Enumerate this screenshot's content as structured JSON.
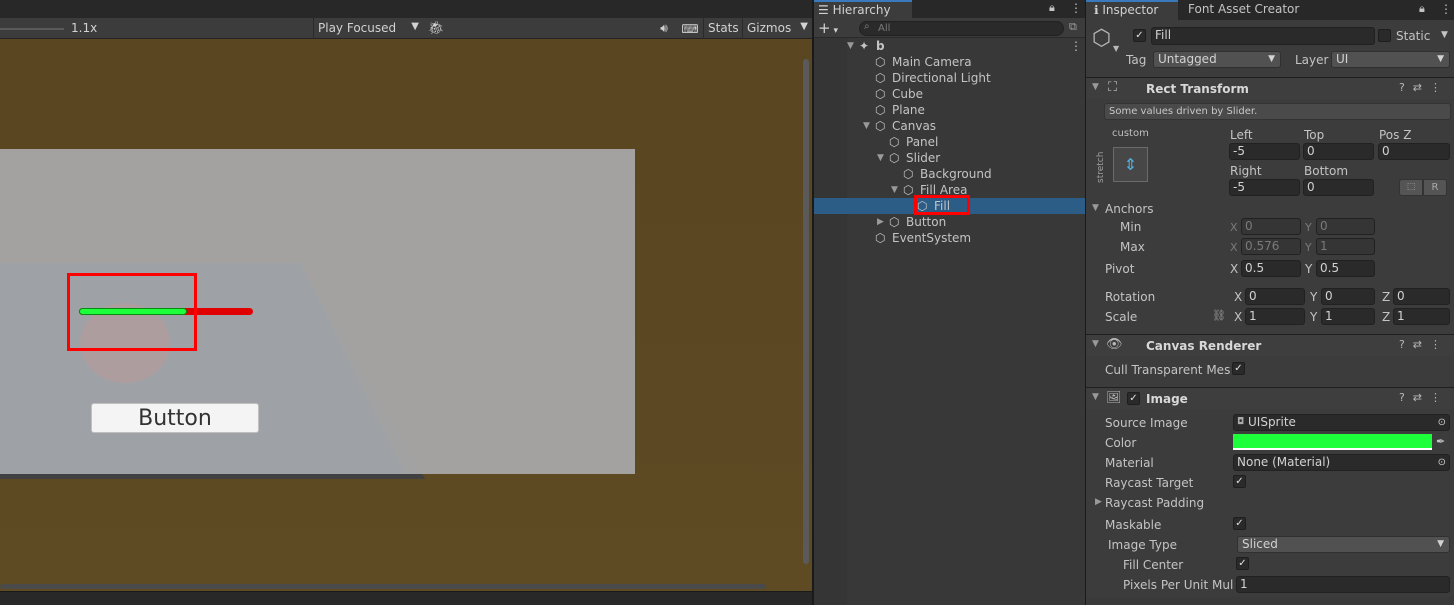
{
  "game": {
    "zoom_value": "1.1x",
    "play_mode": "Play Focused",
    "stats_label": "Stats",
    "gizmos_label": "Gizmos",
    "button_text": "Button",
    "slider_fill_fraction": 0.62,
    "slider_fill_color": "#1dff3a",
    "slider_bg_color": "#e00000"
  },
  "hierarchy": {
    "tab_label": "Hierarchy",
    "search_placeholder": "All",
    "items": [
      {
        "label": "b",
        "depth": 0,
        "scene": true,
        "expanded": true
      },
      {
        "label": "Main Camera",
        "depth": 1
      },
      {
        "label": "Directional Light",
        "depth": 1
      },
      {
        "label": "Cube",
        "depth": 1
      },
      {
        "label": "Plane",
        "depth": 1
      },
      {
        "label": "Canvas",
        "depth": 1,
        "expanded": true
      },
      {
        "label": "Panel",
        "depth": 2
      },
      {
        "label": "Slider",
        "depth": 2,
        "expanded": true
      },
      {
        "label": "Background",
        "depth": 3
      },
      {
        "label": "Fill Area",
        "depth": 3,
        "expanded": true
      },
      {
        "label": "Fill",
        "depth": 4,
        "selected": true
      },
      {
        "label": "Button",
        "depth": 2,
        "collapsed": true
      },
      {
        "label": "EventSystem",
        "depth": 1
      }
    ]
  },
  "inspector": {
    "tab_label": "Inspector",
    "tab2_label": "Font Asset Creator",
    "object_name": "Fill",
    "static_label": "Static",
    "tag_label": "Tag",
    "tag_value": "Untagged",
    "layer_label": "Layer",
    "layer_value": "UI",
    "rect_transform": {
      "title": "Rect Transform",
      "note": "Some values driven by Slider.",
      "anchor_preset": "custom",
      "stretch_label": "stretch",
      "left_label": "Left",
      "left": "-5",
      "top_label": "Top",
      "top": "0",
      "posz_label": "Pos Z",
      "posz": "0",
      "right_label": "Right",
      "right": "-5",
      "bottom_label": "Bottom",
      "bottom": "0",
      "r_button": "R",
      "anchors_label": "Anchors",
      "min_label": "Min",
      "min_x": "0",
      "min_y": "0",
      "max_label": "Max",
      "max_x": "0.576",
      "max_y": "1",
      "pivot_label": "Pivot",
      "pivot_x": "0.5",
      "pivot_y": "0.5",
      "rotation_label": "Rotation",
      "rot_x": "0",
      "rot_y": "0",
      "rot_z": "0",
      "scale_label": "Scale",
      "scale_x": "1",
      "scale_y": "1",
      "scale_z": "1",
      "x": "X",
      "y": "Y",
      "z": "Z"
    },
    "canvas_renderer": {
      "title": "Canvas Renderer",
      "cull_label": "Cull Transparent Mesh"
    },
    "image": {
      "title": "Image",
      "source_image_label": "Source Image",
      "source_image": "UISprite",
      "color_label": "Color",
      "color": "#1dff3a",
      "material_label": "Material",
      "material": "None (Material)",
      "raycast_target_label": "Raycast Target",
      "raycast_padding_label": "Raycast Padding",
      "maskable_label": "Maskable",
      "image_type_label": "Image Type",
      "image_type": "Sliced",
      "fill_center_label": "Fill Center",
      "ppu_label": "Pixels Per Unit Multiplier",
      "ppu": "1"
    }
  }
}
